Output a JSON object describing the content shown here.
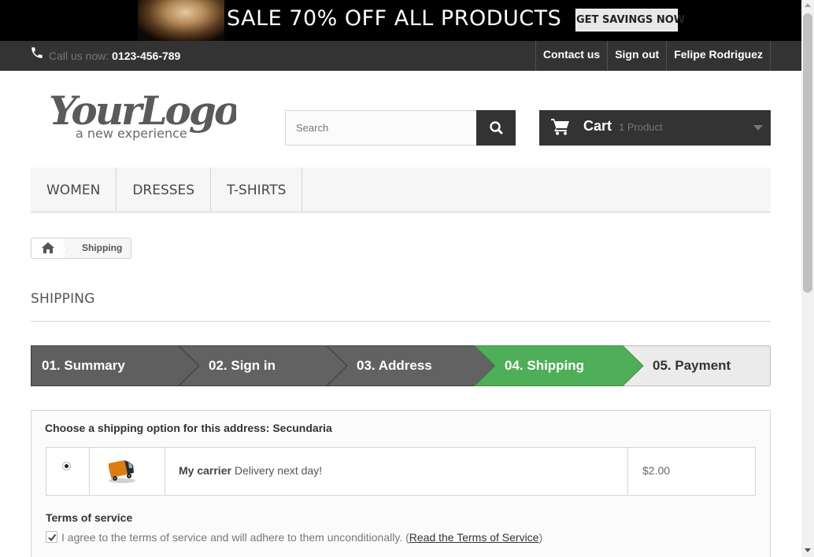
{
  "banner": {
    "text": "SALE 70% OFF ALL PRODUCTS",
    "button_label": "GET SAVINGS NOW"
  },
  "topnav": {
    "call_label": "Call us now:",
    "phone": "0123-456-789",
    "links": [
      "Contact us",
      "Sign out",
      "Felipe Rodriguez"
    ]
  },
  "logo": {
    "wordmark": "YourLogo",
    "tagline": "a new experience"
  },
  "search": {
    "placeholder": "Search"
  },
  "cart": {
    "label": "Cart",
    "count": "1 Product"
  },
  "menu": {
    "items": [
      "WOMEN",
      "DRESSES",
      "T-SHIRTS"
    ]
  },
  "breadcrumb": {
    "current": "Shipping"
  },
  "page": {
    "heading": "SHIPPING"
  },
  "steps": {
    "items": [
      "01. Summary",
      "02. Sign in",
      "03. Address",
      "04. Shipping",
      "05. Payment"
    ],
    "active_index": 3
  },
  "shipping": {
    "choose_label": "Choose a shipping option for this address: Secundaria",
    "selected": true,
    "carrier_name": "My carrier",
    "carrier_delay": "Delivery next day!",
    "price": "$2.00"
  },
  "terms": {
    "title": "Terms of service",
    "checked": true,
    "agree_text": "I agree to the terms of service and will adhere to them unconditionally.",
    "link_text": "Read the Terms of Service"
  },
  "colors": {
    "dark": "#333333",
    "active_step": "#4fae58",
    "inactive_step": "#5f5f5f"
  },
  "icons": [
    "phone-icon",
    "search-icon",
    "cart-icon",
    "home-icon",
    "truck-icon",
    "checkmark-icon",
    "caret-down-icon"
  ]
}
